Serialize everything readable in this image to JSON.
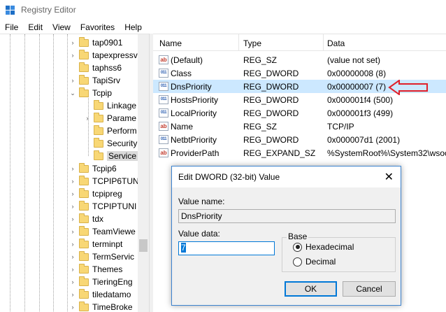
{
  "window": {
    "title": "Registry Editor"
  },
  "menu": [
    "File",
    "Edit",
    "View",
    "Favorites",
    "Help"
  ],
  "tree": {
    "items": [
      {
        "label": "tap0901",
        "chevron": "›"
      },
      {
        "label": "tapexpressv",
        "chevron": "›"
      },
      {
        "label": "taphss6",
        "chevron": ""
      },
      {
        "label": "TapiSrv",
        "chevron": "›"
      },
      {
        "label": "Tcpip",
        "chevron": "⌄"
      },
      {
        "label": "Linkage",
        "chevron": ""
      },
      {
        "label": "Parame",
        "chevron": "›"
      },
      {
        "label": "Perform",
        "chevron": ""
      },
      {
        "label": "Security",
        "chevron": ""
      },
      {
        "label": "Service",
        "chevron": ""
      },
      {
        "label": "Tcpip6",
        "chevron": "›"
      },
      {
        "label": "TCPIP6TUN",
        "chevron": "›"
      },
      {
        "label": "tcpipreg",
        "chevron": "›"
      },
      {
        "label": "TCPIPTUNI",
        "chevron": "›"
      },
      {
        "label": "tdx",
        "chevron": "›"
      },
      {
        "label": "TeamViewe",
        "chevron": "›"
      },
      {
        "label": "terminpt",
        "chevron": "›"
      },
      {
        "label": "TermServic",
        "chevron": "›"
      },
      {
        "label": "Themes",
        "chevron": "›"
      },
      {
        "label": "TieringEng",
        "chevron": "›"
      },
      {
        "label": "tiledatamo",
        "chevron": "›"
      },
      {
        "label": "TimeBroke",
        "chevron": "›"
      }
    ]
  },
  "list": {
    "columns": {
      "name": "Name",
      "type": "Type",
      "data": "Data"
    },
    "rows": [
      {
        "icon": "string-value-icon",
        "glyph": "ab",
        "name": "(Default)",
        "type": "REG_SZ",
        "data": "(value not set)"
      },
      {
        "icon": "binary-value-icon",
        "glyph": "011",
        "name": "Class",
        "type": "REG_DWORD",
        "data": "0x00000008 (8)"
      },
      {
        "icon": "binary-value-icon",
        "glyph": "011",
        "name": "DnsPriority",
        "type": "REG_DWORD",
        "data": "0x00000007 (7)"
      },
      {
        "icon": "binary-value-icon",
        "glyph": "011",
        "name": "HostsPriority",
        "type": "REG_DWORD",
        "data": "0x000001f4 (500)"
      },
      {
        "icon": "binary-value-icon",
        "glyph": "011",
        "name": "LocalPriority",
        "type": "REG_DWORD",
        "data": "0x000001f3 (499)"
      },
      {
        "icon": "string-value-icon",
        "glyph": "ab",
        "name": "Name",
        "type": "REG_SZ",
        "data": "TCP/IP"
      },
      {
        "icon": "binary-value-icon",
        "glyph": "011",
        "name": "NetbtPriority",
        "type": "REG_DWORD",
        "data": "0x000007d1 (2001)"
      },
      {
        "icon": "string-value-icon",
        "glyph": "ab",
        "name": "ProviderPath",
        "type": "REG_EXPAND_SZ",
        "data": "%SystemRoot%\\System32\\wsoc"
      }
    ]
  },
  "dialog": {
    "title": "Edit DWORD (32-bit) Value",
    "close": "✕",
    "value_name_label": "Value name:",
    "value_name": "DnsPriority",
    "value_data_label": "Value data:",
    "value_data": "7",
    "base_label": "Base",
    "base_options": [
      {
        "label": "Hexadecimal",
        "checked": true
      },
      {
        "label": "Decimal",
        "checked": false
      }
    ],
    "ok_label": "OK",
    "cancel_label": "Cancel"
  },
  "colors": {
    "accent": "#0078d7",
    "selection": "#cce8ff",
    "annotation_arrow": "#e0202a"
  }
}
